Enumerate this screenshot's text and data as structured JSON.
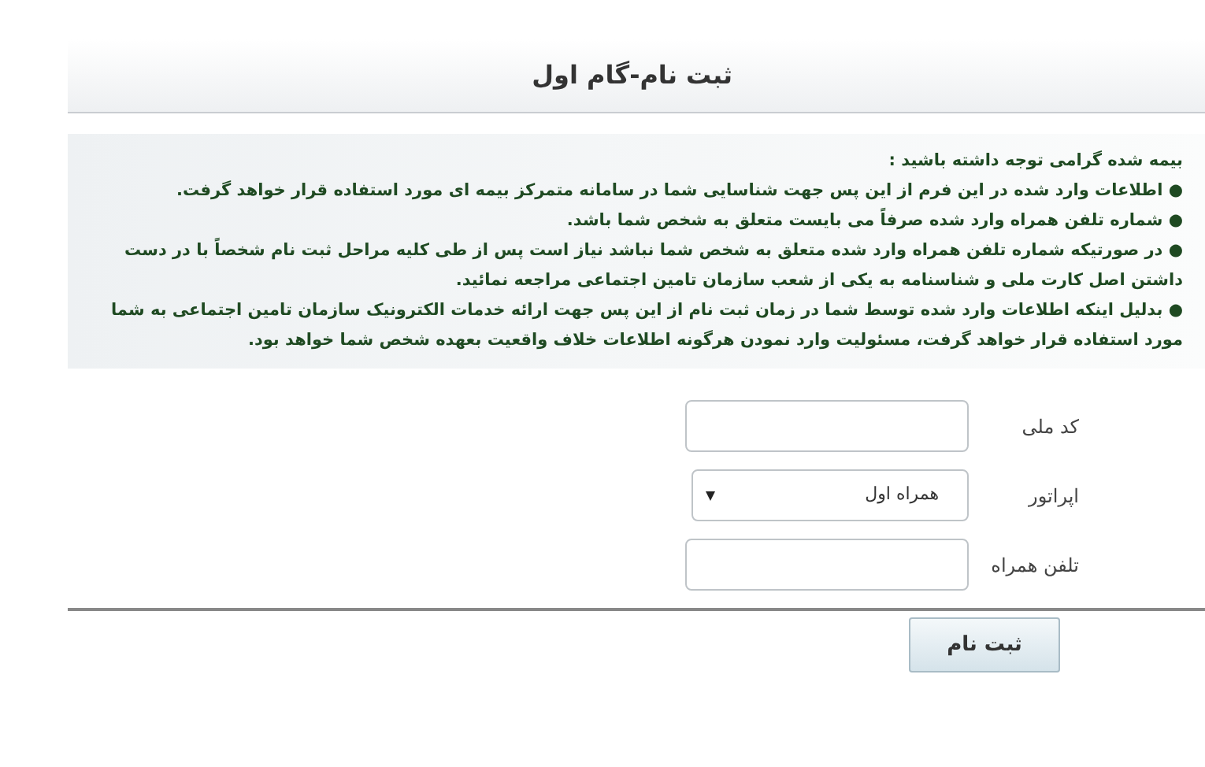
{
  "header": {
    "title": "ثبت نام-گام اول"
  },
  "notice": {
    "heading": "بیمه شده گرامی توجه داشته باشید :",
    "items": [
      {
        "text": "● اطلاعات وارد شده در این فرم از این پس جهت شناسایی شما در سامانه متمرکز بیمه ای مورد استفاده قرار خواهد گرفت."
      },
      {
        "text": "● شماره تلفن همراه وارد شده صرفاً می بایست متعلق به شخص شما باشد."
      },
      {
        "text": "● در صورتیکه شماره تلفن همراه وارد شده متعلق به شخص شما نباشد نیاز است پس از طی کلیه مراحل ثبت نام شخصاً با در دست داشتن اصل کارت ملی و شناسنامه به یکی از شعب سازمان تامین اجتماعی مراجعه نمائید."
      },
      {
        "text": "● بدلیل اینکه اطلاعات وارد شده توسط شما در زمان ثبت نام از این پس جهت ارائه خدمات الکترونیک سازمان تامین اجتماعی به شما مورد استفاده قرار خواهد گرفت، مسئولیت وارد نمودن هرگونه اطلاعات خلاف واقعیت بعهده شخص شما خواهد بود."
      }
    ]
  },
  "form": {
    "fields": [
      {
        "kind": "text",
        "label": "کد ملی"
      },
      {
        "kind": "select",
        "label": "اپراتور",
        "value": "همراه اول"
      },
      {
        "kind": "text",
        "label": "تلفن همراه"
      }
    ]
  },
  "submit_button": "ثبت نام"
}
